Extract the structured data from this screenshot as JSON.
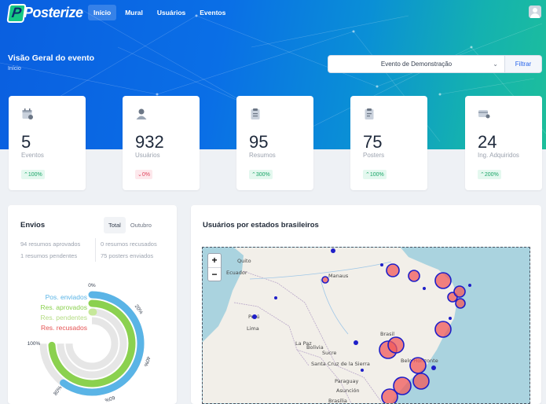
{
  "brand": {
    "name": "Posterize",
    "badge_letter": "P"
  },
  "nav": {
    "items": [
      "Início",
      "Mural",
      "Usuários",
      "Eventos"
    ],
    "active": 0
  },
  "header": {
    "title": "Visão Geral do evento",
    "breadcrumb": "Início"
  },
  "filter": {
    "selected_event": "Evento de Demonstração",
    "button_label": "Filtrar"
  },
  "stats": [
    {
      "value": "5",
      "label": "Eventos",
      "delta": "100%",
      "trend": "up",
      "icon": "calendar-icon"
    },
    {
      "value": "932",
      "label": "Usuários",
      "delta": "0%",
      "trend": "down",
      "icon": "user-icon"
    },
    {
      "value": "95",
      "label": "Resumos",
      "delta": "300%",
      "trend": "up",
      "icon": "document-icon"
    },
    {
      "value": "75",
      "label": "Posters",
      "delta": "100%",
      "trend": "up",
      "icon": "clipboard-icon"
    },
    {
      "value": "24",
      "label": "Ing. Adquiridos",
      "delta": "200%",
      "trend": "up",
      "icon": "ticket-icon"
    }
  ],
  "envios": {
    "title": "Envios",
    "tabs": [
      "Total",
      "Outubro"
    ],
    "active_tab": 0,
    "left_lines": [
      "94 resumos aprovados",
      "1 resumos pendentes"
    ],
    "right_lines": [
      "0 resumos recusados",
      "75 posters enviados"
    ],
    "legend": [
      {
        "label": "Pos. enviados",
        "color": "#5ab4e6"
      },
      {
        "label": "Res. aprovados",
        "color": "#8bd14f"
      },
      {
        "label": "Res. pendentes",
        "color": "#c6e89a"
      },
      {
        "label": "Res. recusados",
        "color": "#e55353"
      }
    ],
    "scale_labels": [
      "0%",
      "20%",
      "40%",
      "60%",
      "80%",
      "100%"
    ],
    "arc_values": [
      0.8,
      0.99,
      0.01,
      0.0
    ]
  },
  "map": {
    "title": "Usuários por estados brasileiros",
    "zoom_in": "+",
    "zoom_out": "−",
    "place_labels": [
      "Quito",
      "Ecuador",
      "Manaus",
      "Perú",
      "Lima",
      "Bolivia",
      "La Paz",
      "Santa Cruz de la Sierra",
      "Sucre",
      "Paraguay",
      "Asunción",
      "Brasil",
      "Belo Horizonte",
      "Brasília"
    ]
  },
  "colors": {
    "accent": "#2563eb",
    "up": "#1aa567",
    "down": "#e0435c"
  }
}
